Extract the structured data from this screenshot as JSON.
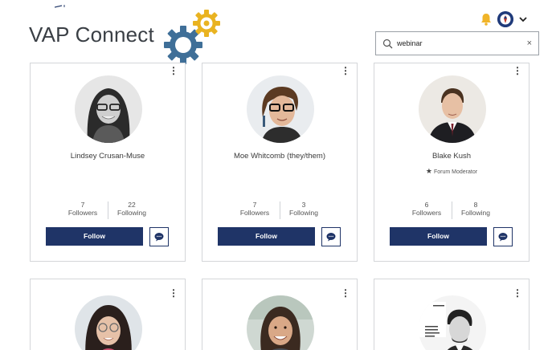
{
  "app": {
    "title": "VAP Connect"
  },
  "colors": {
    "brand_navy": "#1f3467",
    "gear_blue": "#3f6f98",
    "gear_gold": "#e9b321",
    "bell_gold": "#f0b429",
    "border": "#d4d6d9"
  },
  "header": {
    "icons": [
      "gears-logo-icon",
      "bell-icon",
      "user-avatar",
      "chevron-down-icon"
    ]
  },
  "search": {
    "value": "webinar",
    "placeholder": "Search",
    "clear": "×"
  },
  "members": [
    {
      "name": "Lindsey Crusan-Muse",
      "role": "",
      "followers": "7",
      "followers_label": "Followers",
      "following": "22",
      "following_label": "Following",
      "follow_label": "Follow"
    },
    {
      "name": "Moe Whitcomb (they/them)",
      "role": "",
      "followers": "7",
      "followers_label": "Followers",
      "following": "3",
      "following_label": "Following",
      "follow_label": "Follow"
    },
    {
      "name": "Blake Kush",
      "role": "Forum Moderator",
      "followers": "6",
      "followers_label": "Followers",
      "following": "8",
      "following_label": "Following",
      "follow_label": "Follow"
    },
    {
      "name": "",
      "role": ""
    },
    {
      "name": "",
      "role": ""
    },
    {
      "name": "",
      "role": ""
    }
  ]
}
